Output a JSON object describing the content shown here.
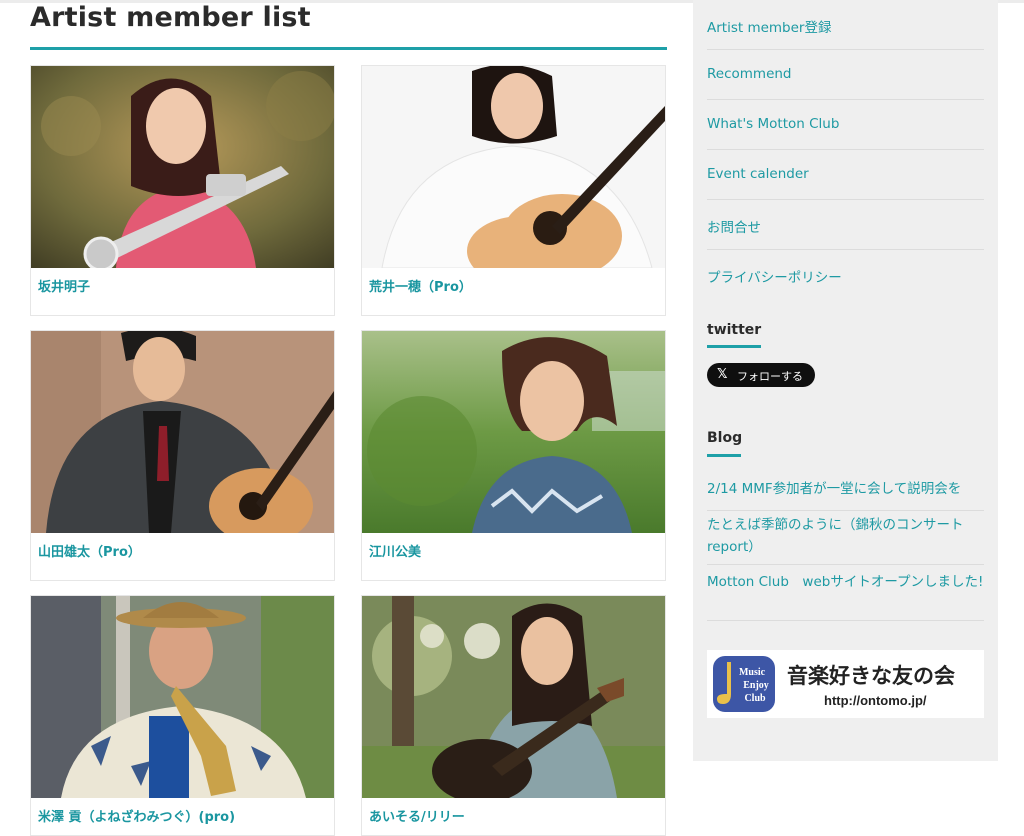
{
  "page": {
    "title": "Artist member list"
  },
  "artists": [
    {
      "name": "坂井明子"
    },
    {
      "name": "荒井一穂（Pro）"
    },
    {
      "name": "山田雄太（Pro）"
    },
    {
      "name": "江川公美"
    },
    {
      "name": "米澤 貢（よねざわみつぐ）(pro)"
    },
    {
      "name": "あいそる/リリー"
    }
  ],
  "sidebar": {
    "links": [
      {
        "label": "Artist member登録"
      },
      {
        "label": "Recommend"
      },
      {
        "label": "What's Motton Club"
      },
      {
        "label": "Event calender"
      },
      {
        "label": "お問合せ"
      },
      {
        "label": "プライバシーポリシー"
      }
    ],
    "twitter": {
      "heading": "twitter",
      "follow_x": "𝕏",
      "follow_label": "フォローする"
    },
    "blog": {
      "heading": "Blog",
      "posts": [
        {
          "title": "2/14 MMF参加者が一堂に会して説明会を"
        },
        {
          "title": "たとえば季節のように（錦秋のコンサートreport）"
        },
        {
          "title": "Motton Club　webサイトオープンしました!"
        }
      ]
    },
    "banner": {
      "logo_line1": "Music",
      "logo_line2": "Enjoy",
      "logo_line3": "Club",
      "title": "音楽好きな友の会",
      "url": "http://ontomo.jp/"
    }
  },
  "colors": {
    "accent": "#1ea0a8",
    "link": "#1e9aa3",
    "sidebar_bg": "#efefef"
  }
}
